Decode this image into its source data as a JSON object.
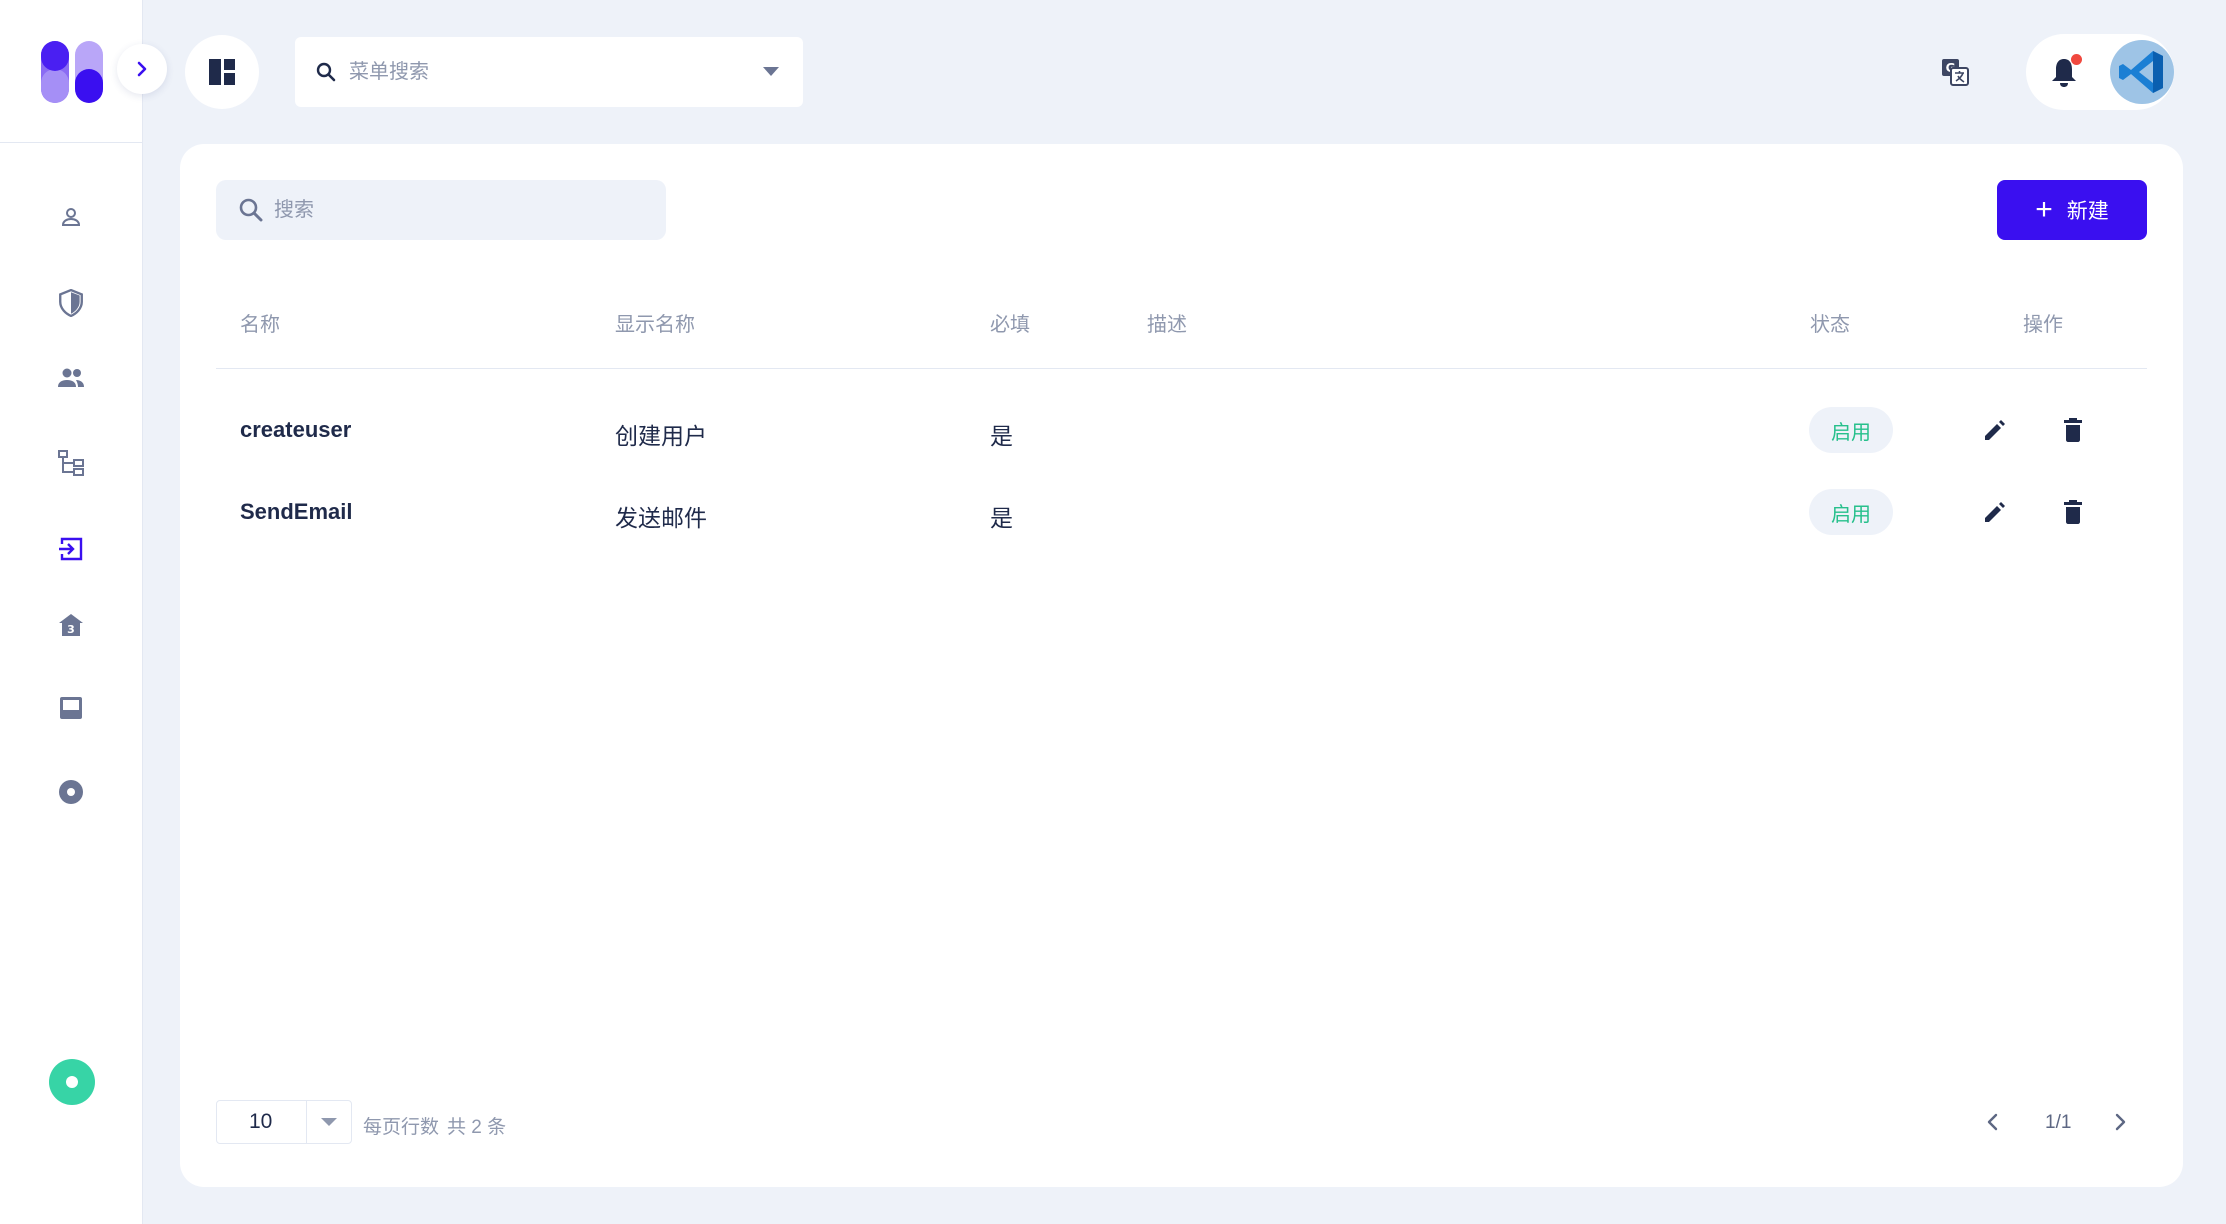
{
  "header": {
    "menu_search": {
      "placeholder": "菜单搜索"
    }
  },
  "toolbar": {
    "search_placeholder": "搜索",
    "new_button_label": "新建",
    "new_button_icon": "plus-icon"
  },
  "table": {
    "columns": [
      "名称",
      "显示名称",
      "必填",
      "描述",
      "状态",
      "操作"
    ],
    "rows": [
      {
        "name": "createuser",
        "display_name": "创建用户",
        "required": "是",
        "description": "",
        "status": "启用"
      },
      {
        "name": "SendEmail",
        "display_name": "发送邮件",
        "required": "是",
        "description": "",
        "status": "启用"
      }
    ]
  },
  "footer": {
    "page_size": "10",
    "rows_per_page_label": "每页行数",
    "total_label": "共 2 条",
    "page_indicator": "1/1"
  },
  "sidebar": {
    "icons": [
      "user-icon",
      "shield-icon",
      "group-icon",
      "org-tree-icon",
      "login-icon",
      "house-icon",
      "panel-icon",
      "record-icon"
    ]
  },
  "colors": {
    "accent": "#3a0ff0",
    "status_enabled": "#27c08c",
    "status_dot": "#37d4a6",
    "notification_dot": "#f0483e"
  }
}
